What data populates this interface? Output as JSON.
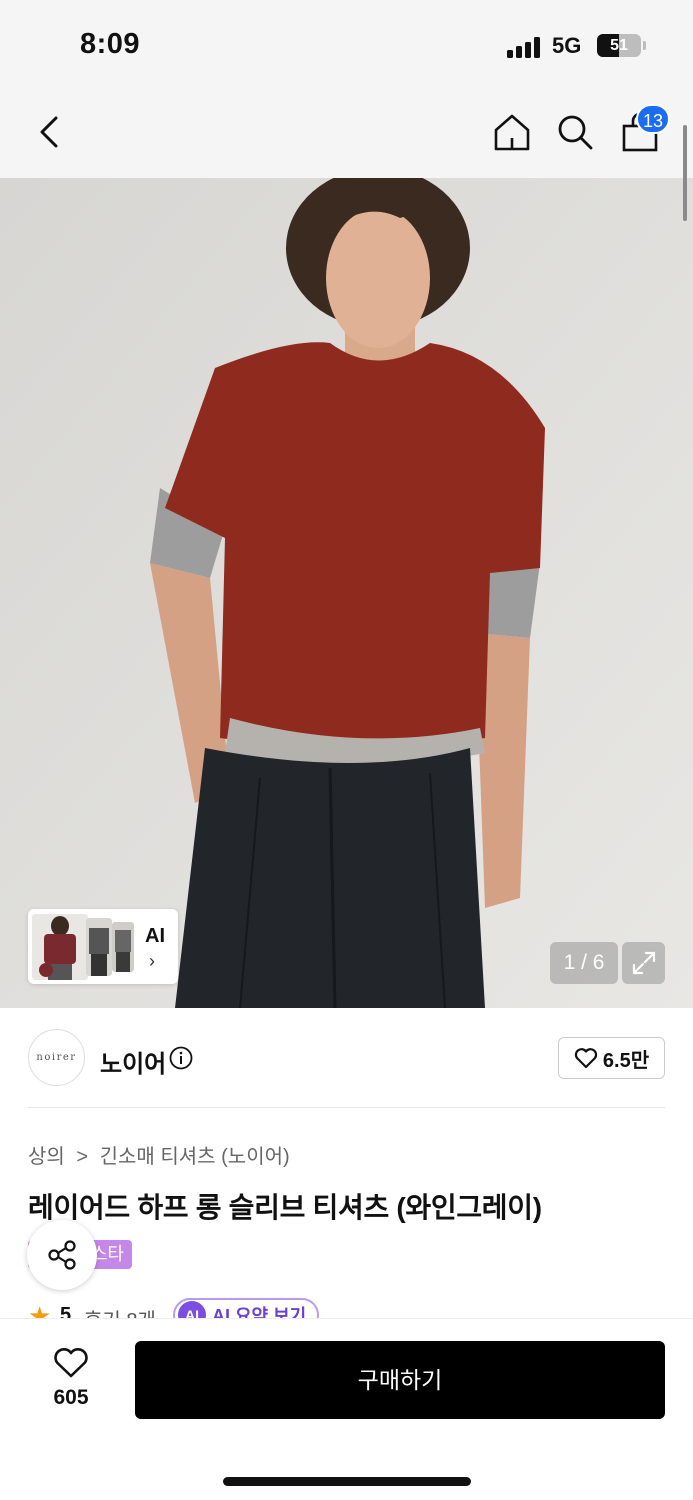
{
  "status_bar": {
    "time": "8:09",
    "network": "5G",
    "battery": "51",
    "battery_level": 0.51
  },
  "nav": {
    "back_icon": "chevron-left-icon",
    "home_icon": "home-icon",
    "search_icon": "search-icon",
    "cart_icon": "shopping-bag-icon",
    "cart_badge": "13"
  },
  "gallery": {
    "ai_label": "AI",
    "ai_chevron": "›",
    "counter": "1 / 6",
    "expand_icon": "expand-icon"
  },
  "brand": {
    "logo_text": "noirer",
    "name": "노이어",
    "likes": "6.5만"
  },
  "product": {
    "breadcrumb": [
      "상의",
      "긴소매 티셔츠 (노이어)"
    ],
    "breadcrumb_sep": ">",
    "title": "레이어드 하프 롱 슬리브 티셔츠 (와인그레이)",
    "tag": "스타",
    "rating": "5",
    "review_count": "후기 8개",
    "ai_badge": "AI",
    "ai_summary": "AI 요약 보기"
  },
  "bottom": {
    "wish_count": "605",
    "buy_label": "구매하기"
  },
  "colors": {
    "accent_blue": "#1a6cf0",
    "tag_purple": "#c688e8",
    "ai_purple": "#7b4de0",
    "star": "#f39c12"
  }
}
